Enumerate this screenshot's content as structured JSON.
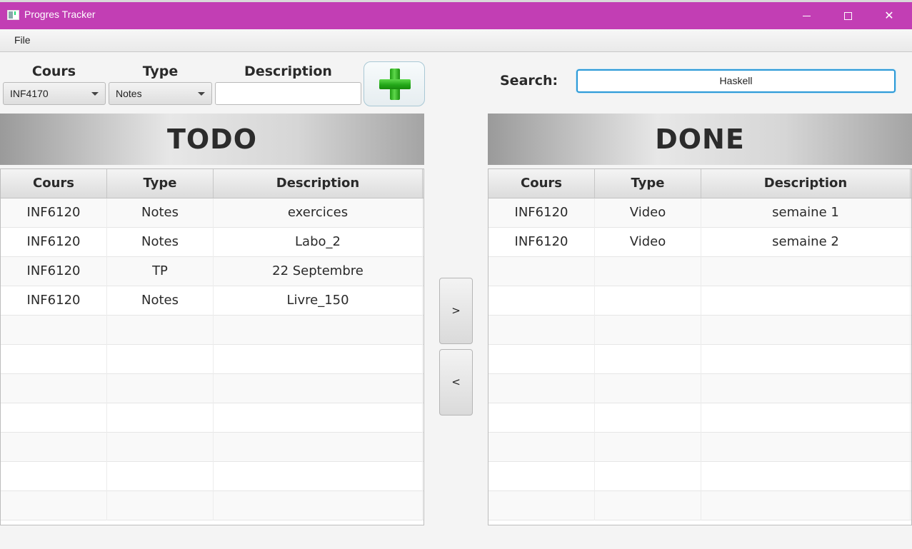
{
  "window": {
    "title": "Progres Tracker"
  },
  "menu": {
    "file": "File"
  },
  "form": {
    "cours_label": "Cours",
    "type_label": "Type",
    "description_label": "Description",
    "cours_selected": "INF4170",
    "type_selected": "Notes",
    "description_value": ""
  },
  "search": {
    "label": "Search:",
    "value": "Haskell"
  },
  "todo": {
    "title": "TODO",
    "columns": [
      "Cours",
      "Type",
      "Description"
    ],
    "rows": [
      [
        "INF6120",
        "Notes",
        "exercices"
      ],
      [
        "INF6120",
        "Notes",
        "Labo_2"
      ],
      [
        "INF6120",
        "TP",
        "22 Septembre"
      ],
      [
        "INF6120",
        "Notes",
        "Livre_150"
      ]
    ]
  },
  "done": {
    "title": "DONE",
    "columns": [
      "Cours",
      "Type",
      "Description"
    ],
    "rows": [
      [
        "INF6120",
        "Video",
        "semaine 1"
      ],
      [
        "INF6120",
        "Video",
        "semaine 2"
      ]
    ]
  },
  "actions": {
    "move_to_done": ">",
    "move_to_todo": "<"
  },
  "icons": {
    "add": "green-plus-icon",
    "app": "app-window-icon"
  },
  "colors": {
    "titlebar": "#c23eb4",
    "search_focus": "#2d9ad7",
    "add_plus": "#2bb41f"
  }
}
